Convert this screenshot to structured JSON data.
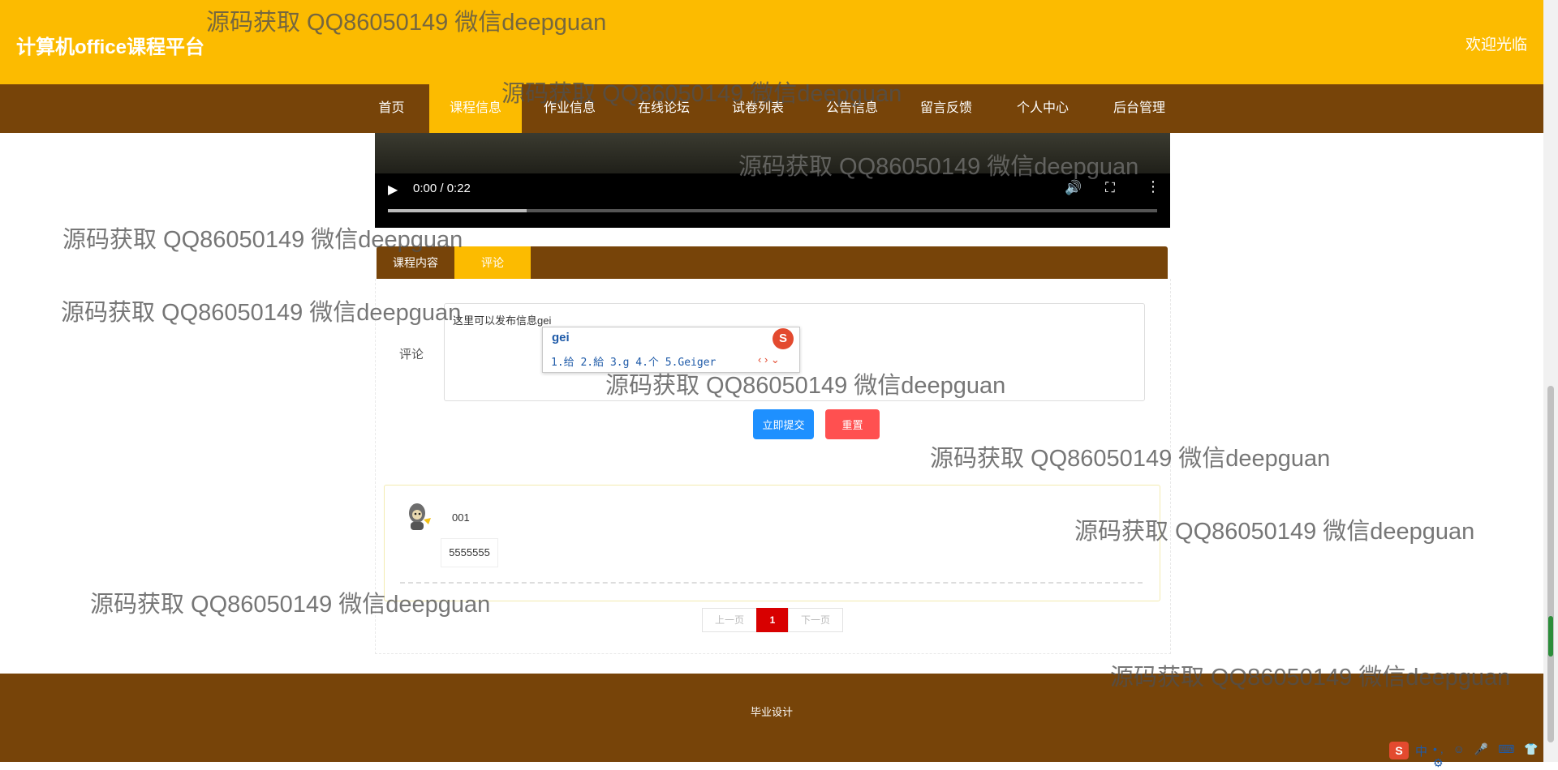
{
  "header": {
    "site_title": "计算机office课程平台",
    "welcome": "欢迎光临"
  },
  "nav": {
    "items": [
      "首页",
      "课程信息",
      "作业信息",
      "在线论坛",
      "试卷列表",
      "公告信息",
      "留言反馈",
      "个人中心",
      "后台管理"
    ],
    "active": "课程信息"
  },
  "video": {
    "time": "0:00 / 0:22",
    "progress": 0.18
  },
  "tabs": {
    "items": [
      "课程内容",
      "评论"
    ],
    "active": "评论"
  },
  "comment_form": {
    "label": "评论",
    "value": "这里可以发布信息gei",
    "submit_label": "立即提交",
    "reset_label": "重置"
  },
  "ime": {
    "input": "gei",
    "candidates": "1.给  2.給  3.g  4.个  5.Geiger",
    "logo": "S"
  },
  "comments": [
    {
      "user": "001",
      "text": "5555555"
    }
  ],
  "pagination": {
    "prev": "上一页",
    "current": "1",
    "next": "下一页"
  },
  "footer": {
    "text": "毕业设计"
  },
  "tray": {
    "logo": "S",
    "lang": "中"
  },
  "watermark": "源码获取 QQ86050149 微信deepguan"
}
